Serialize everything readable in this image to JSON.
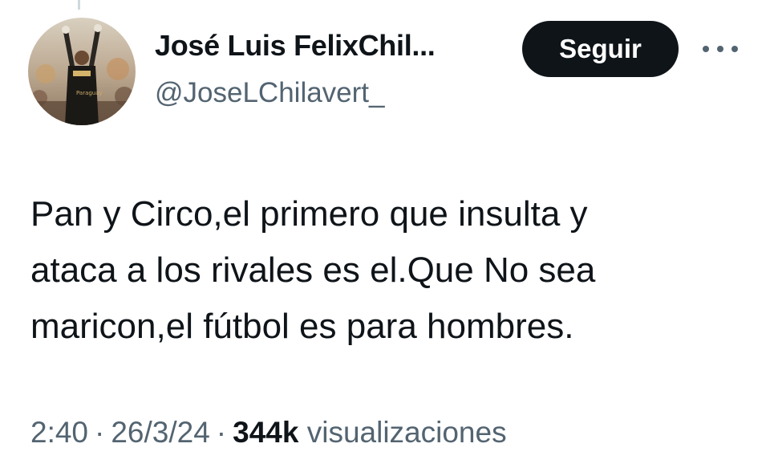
{
  "author": {
    "display_name": "José Luis FelixChil...",
    "handle": "@JoseLChilavert_"
  },
  "actions": {
    "follow_label": "Seguir",
    "more_icon": "more-horizontal-icon"
  },
  "tweet": {
    "text": "Pan y Circo,el primero que insulta y\nataca a los rivales es el.Que No sea\nmaricon,el fútbol es para hombres.",
    "time": "2:40",
    "separator": "·",
    "date": "26/3/24",
    "views_count": "344k",
    "views_label": "visualizaciones"
  },
  "colors": {
    "text_primary": "#0f1419",
    "text_secondary": "#536471",
    "button_bg": "#0f1419"
  }
}
